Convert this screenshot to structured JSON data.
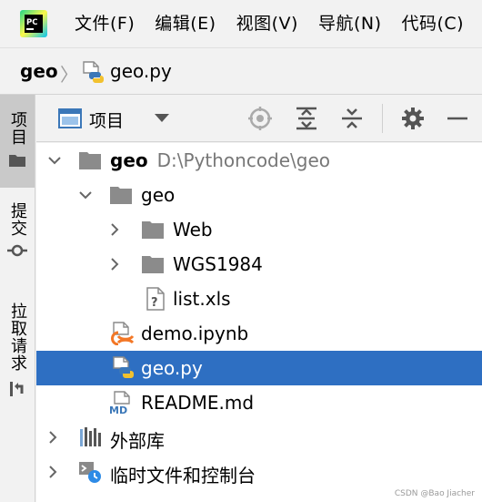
{
  "menu": {
    "app_logo_text": "PC",
    "items": [
      "文件(F)",
      "编辑(E)",
      "视图(V)",
      "导航(N)",
      "代码(C)"
    ]
  },
  "breadcrumb": {
    "root": "geo",
    "separator": "〉",
    "file": "geo.py"
  },
  "toolstrip": {
    "tabs": [
      "项目",
      "提交",
      "拉取请求"
    ]
  },
  "panel": {
    "title": "项目",
    "icons": [
      "locate-icon",
      "expand-all-icon",
      "collapse-all-icon",
      "gear-icon",
      "minimize-icon"
    ]
  },
  "tree": {
    "root_name": "geo",
    "root_path": "D:\\Pythoncode\\geo",
    "items": [
      {
        "label": "geo",
        "icon": "folder-icon"
      },
      {
        "label": "Web",
        "icon": "folder-icon"
      },
      {
        "label": "WGS1984",
        "icon": "folder-icon"
      },
      {
        "label": "list.xls",
        "icon": "unknown-file-icon"
      },
      {
        "label": "demo.ipynb",
        "icon": "jupyter-file-icon"
      },
      {
        "label": "geo.py",
        "icon": "python-file-icon",
        "selected": true
      },
      {
        "label": "README.md",
        "icon": "markdown-file-icon"
      },
      {
        "label": "外部库",
        "icon": "library-icon"
      },
      {
        "label": "临时文件和控制台",
        "icon": "scratches-icon"
      }
    ]
  },
  "colors": {
    "selection": "#2e6fc2",
    "background": "#f2f2f2",
    "tree_background": "#ffffff"
  },
  "watermark": "CSDN @Bao Jiacher"
}
